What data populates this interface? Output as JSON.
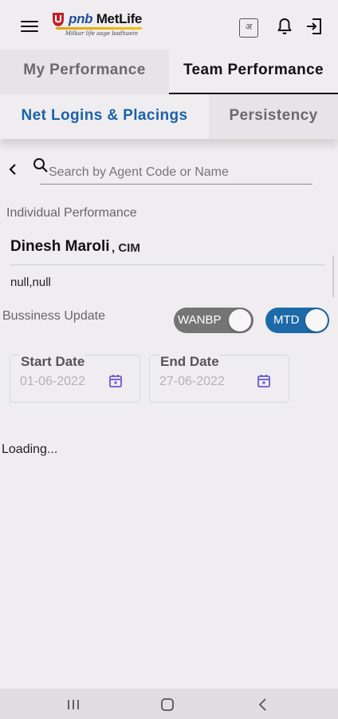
{
  "header": {
    "logo_brand_pnb": "pnb",
    "logo_brand_metlife": " MetLife",
    "logo_tagline": "Milkar life aage badhaein",
    "lang_icon_glyph": "अ",
    "icons": [
      "menu-icon",
      "language-icon",
      "bell-icon",
      "logout-icon"
    ],
    "brand_color": "#1d4f9a",
    "accent_color": "#e0a300"
  },
  "tabs": {
    "primary": [
      {
        "label": "My Performance",
        "active": false
      },
      {
        "label": "Team Performance",
        "active": true
      }
    ],
    "secondary": [
      {
        "label": "Net Logins & Placings",
        "active": true
      },
      {
        "label": "Persistency",
        "active": false
      }
    ],
    "active_color": "#1a63a8"
  },
  "search": {
    "placeholder": "Search by Agent Code or Name",
    "value": ""
  },
  "individual": {
    "section_label": "Individual Performance",
    "agent_name": "Dinesh Maroli",
    "agent_role": ", CIM",
    "agent_location": "null,null"
  },
  "business_update": {
    "label": "Bussiness Update",
    "toggles": [
      {
        "label": "WANBP",
        "on": false,
        "color": "#757575"
      },
      {
        "label": "MTD",
        "on": true,
        "color": "#1c6aa8"
      }
    ]
  },
  "dates": {
    "start": {
      "label": "Start Date",
      "value": "01-06-2022"
    },
    "end": {
      "label": "End Date",
      "value": "27-06-2022"
    }
  },
  "status": {
    "loading_text": "Loading..."
  },
  "navbar": {
    "icons": [
      "recent-apps-icon",
      "home-icon",
      "back-icon"
    ]
  }
}
